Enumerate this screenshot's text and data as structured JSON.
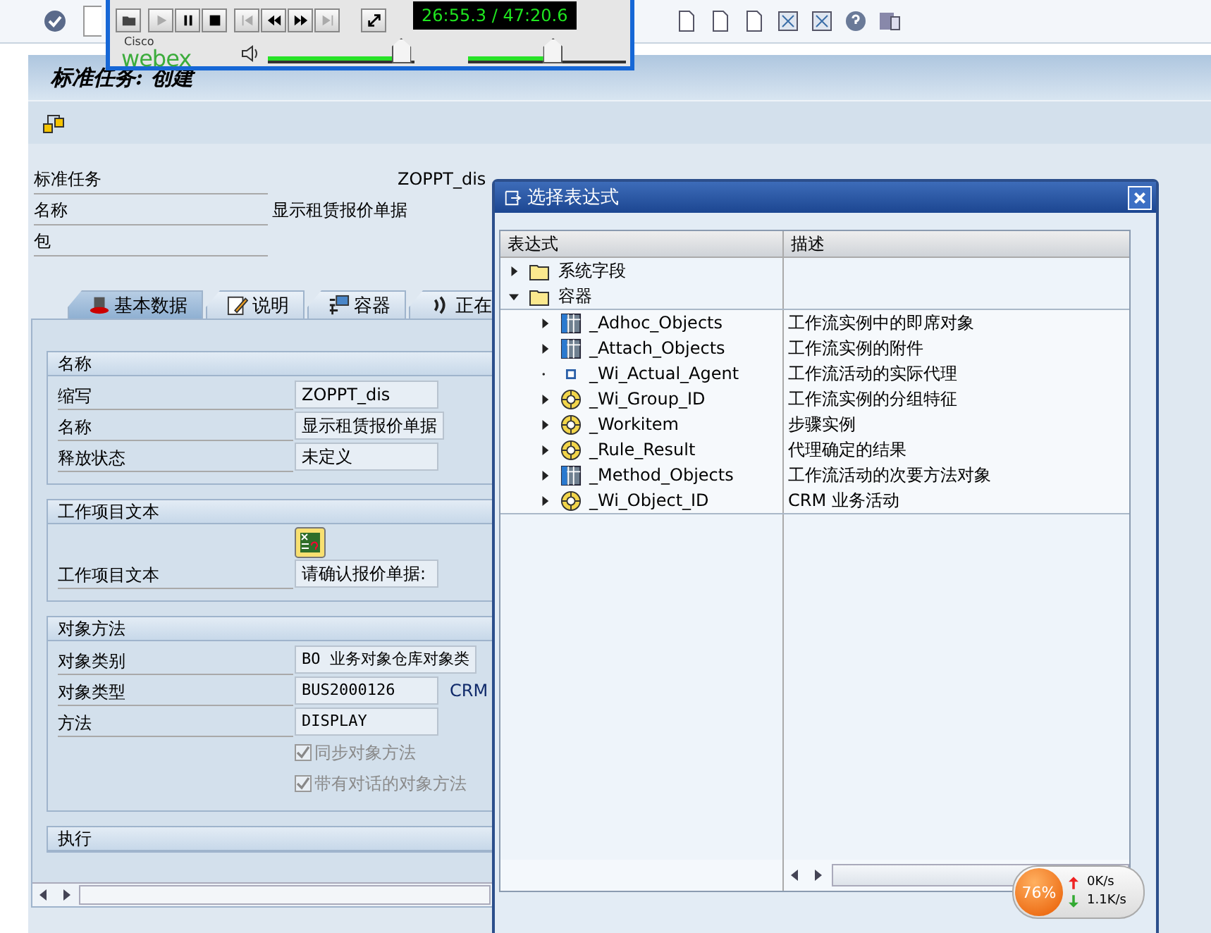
{
  "screen": {
    "title": "标准任务: 创建"
  },
  "header_fields": [
    {
      "label": "标准任务",
      "value": "ZOPPT_dis"
    },
    {
      "label": "名称",
      "value": "显示租赁报价单据"
    },
    {
      "label": "包"
    }
  ],
  "tabs": [
    {
      "label": "基本数据",
      "selected": true,
      "kind": "hat"
    },
    {
      "label": "说明",
      "selected": false,
      "kind": "pencil"
    },
    {
      "label": "容器",
      "selected": false,
      "kind": "container"
    },
    {
      "label": "正在",
      "selected": false,
      "kind": "signal"
    }
  ],
  "groups": [
    {
      "title": "名称",
      "fields": [
        {
          "kind": "field",
          "label": "缩写",
          "value": "ZOPPT_dis"
        },
        {
          "kind": "field",
          "label": "名称",
          "value": "显示租赁报价单据"
        },
        {
          "kind": "field",
          "label": "释放状态",
          "value": "未定义"
        }
      ]
    },
    {
      "title": "工作项目文本",
      "fields": [
        {
          "kind": "picker"
        },
        {
          "kind": "field",
          "label": "工作项目文本",
          "value": "请确认报价单据:"
        }
      ]
    },
    {
      "title": "对象方法",
      "fields": [
        {
          "kind": "field",
          "label": "对象类别",
          "value": "BO 业务对象仓库对象类"
        },
        {
          "kind": "field",
          "label": "对象类型",
          "value": "BUS2000126",
          "extra": "CRM"
        },
        {
          "kind": "field",
          "label": "方法",
          "value": "DISPLAY"
        },
        {
          "kind": "checkbox",
          "label": "同步对象方法",
          "checked": true,
          "disabled": true
        },
        {
          "kind": "checkbox",
          "label": "带有对话的对象方法",
          "checked": true,
          "disabled": true
        }
      ]
    },
    {
      "title": "执行"
    }
  ],
  "dialog": {
    "title": "选择表达式",
    "columns": [
      "表达式",
      "描述"
    ],
    "tree": [
      {
        "label": "系统字段",
        "kind": "folder",
        "expanded": false
      },
      {
        "label": "容器",
        "kind": "folder",
        "expanded": true,
        "children": [
          {
            "label": "_Adhoc_Objects",
            "description": "工作流实例中的即席对象",
            "kind": "table",
            "expanded": false
          },
          {
            "label": "_Attach_Objects",
            "description": "工作流实例的附件",
            "kind": "table",
            "expanded": false
          },
          {
            "label": "_Wi_Actual_Agent",
            "description": "工作流活动的实际代理",
            "kind": "field"
          },
          {
            "label": "_Wi_Group_ID",
            "description": "工作流实例的分组特征",
            "kind": "object",
            "expanded": false
          },
          {
            "label": "_Workitem",
            "description": "步骤实例",
            "kind": "object",
            "expanded": false
          },
          {
            "label": "_Rule_Result",
            "description": "代理确定的结果",
            "kind": "object",
            "expanded": false
          },
          {
            "label": "_Method_Objects",
            "description": "工作流活动的次要方法对象",
            "kind": "table",
            "expanded": false
          },
          {
            "label": "_Wi_Object_ID",
            "description": "CRM 业务活动",
            "kind": "object",
            "expanded": false
          }
        ]
      }
    ]
  },
  "player": {
    "logo_top": "Cisco",
    "logo": "webex",
    "time": "26:55.3 / 47:20.6",
    "volume": {
      "level": 0.9
    },
    "position": {
      "level": 0.53
    }
  },
  "net_monitor": {
    "percent": "76%",
    "upload": "0K/s",
    "download": "1.1K/s"
  }
}
